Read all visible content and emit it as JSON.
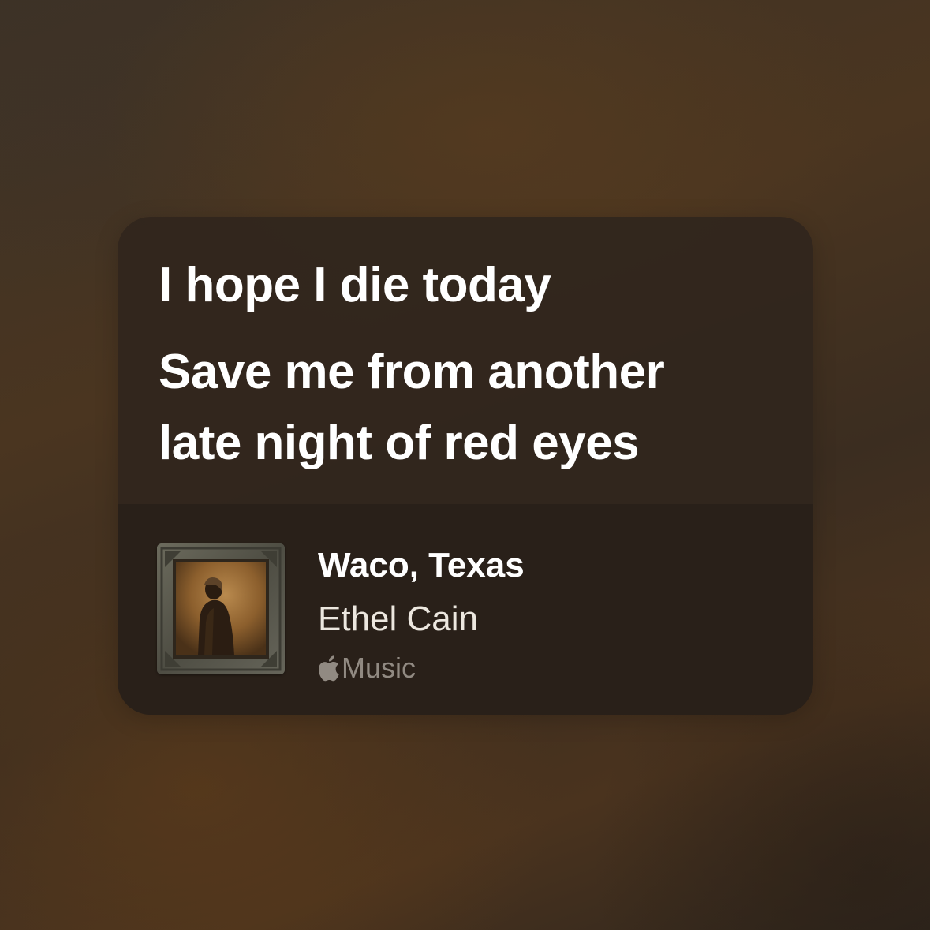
{
  "lyrics": {
    "line1": "I hope I die today",
    "line2": "Save me from another",
    "line3": "late night of red eyes"
  },
  "song": {
    "title": "Waco, Texas",
    "artist": "Ethel Cain",
    "service_label": "Music",
    "service_icon": "apple-logo-icon"
  },
  "colors": {
    "card_bg": "#30261d",
    "text_primary": "#ffffff",
    "text_secondary": "#ece7df",
    "service_text": "#a9a29a"
  }
}
